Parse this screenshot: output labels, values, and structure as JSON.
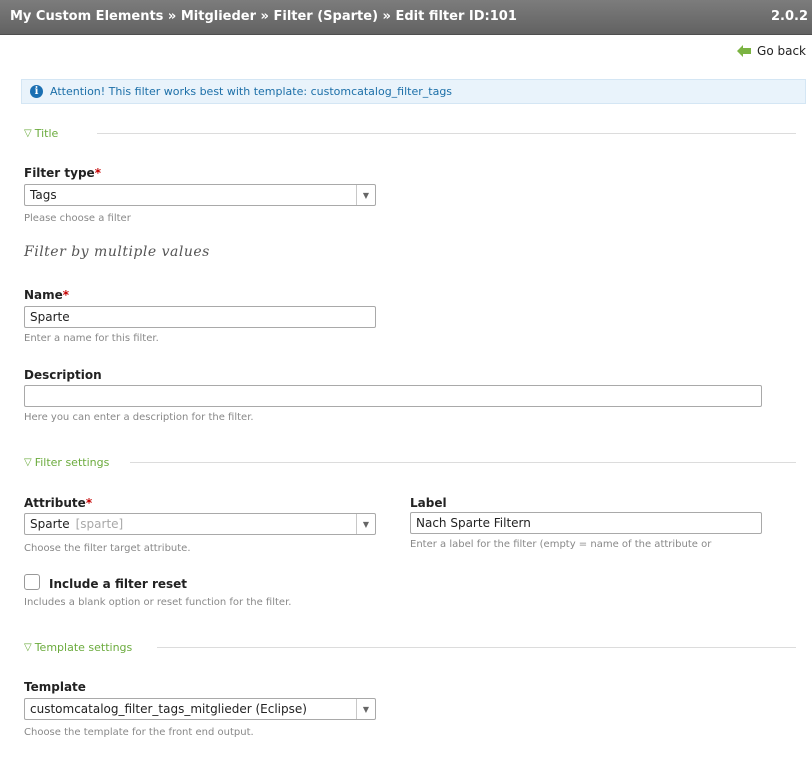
{
  "header": {
    "title": "My Custom Elements » Mitglieder » Filter (Sparte) » Edit filter ID:101",
    "version": "2.0.2"
  },
  "go_back_label": "Go back",
  "attention_text": "Attention! This filter works best with template: customcatalog_filter_tags",
  "sections": {
    "title": "Title",
    "filter_settings": "Filter settings",
    "template_settings": "Template settings"
  },
  "filter_type": {
    "label": "Filter type",
    "required_mark": "*",
    "value": "Tags",
    "hint": "Please choose a filter"
  },
  "filter_subtitle": "Filter by multiple values",
  "name": {
    "label": "Name",
    "required_mark": "*",
    "value": "Sparte",
    "hint": "Enter a name for this filter."
  },
  "description": {
    "label": "Description",
    "value": "",
    "hint": "Here you can enter a description for the filter."
  },
  "attribute": {
    "label": "Attribute",
    "required_mark": "*",
    "value": "Sparte",
    "value_alias": "[sparte]",
    "hint": "Choose the filter target attribute."
  },
  "label_field": {
    "label": "Label",
    "value": "Nach Sparte Filtern",
    "hint": "Enter a label for the filter (empty = name of the attribute or"
  },
  "reset": {
    "label": "Include a filter reset",
    "checked": false,
    "hint": "Includes a blank option or reset function for the filter."
  },
  "template": {
    "label": "Template",
    "value": "customcatalog_filter_tags_mitglieder (Eclipse)",
    "hint": "Choose the template for the front end output."
  },
  "icons": {
    "go_back": "arrow-left-icon",
    "info": "info-icon",
    "section_toggle": "triangle-down-icon",
    "select_arrow": "chevron-down-icon"
  },
  "colors": {
    "header_bg": "#6f6f6f",
    "accent_green": "#6bab3d",
    "info_blue": "#1a6fb2",
    "required_red": "#c40000"
  }
}
